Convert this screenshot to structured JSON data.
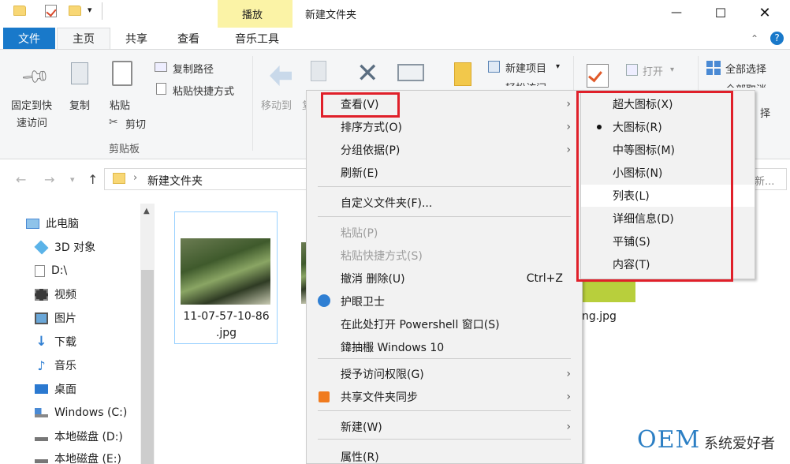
{
  "titlebar": {
    "contextual_tab": "播放",
    "title": "新建文件夹",
    "minimize": "—",
    "maximize": "☐",
    "close": "✕"
  },
  "tabs": {
    "file": "文件",
    "home": "主页",
    "share": "共享",
    "view": "查看",
    "music_tools": "音乐工具"
  },
  "ribbon": {
    "pin_label_1": "固定到快",
    "pin_label_2": "速访问",
    "copy": "复制",
    "paste": "粘贴",
    "copy_path": "复制路径",
    "paste_shortcut": "粘贴快捷方式",
    "cut": "剪切",
    "clipboard_group": "剪贴板",
    "move_to": "移动到",
    "move_to_tail": "复",
    "new_item": "新建项目",
    "easy_access": "轻松访问",
    "open": "打开",
    "select_all": "全部选择",
    "select_none": "全部取消",
    "invert_select_tail": "择"
  },
  "address": {
    "path": "新建文件夹",
    "search_tail": "新..."
  },
  "nav": {
    "items": [
      "此电脑",
      "3D 对象",
      "D:\\",
      "视频",
      "图片",
      "下载",
      "音乐",
      "桌面",
      "Windows (C:)",
      "本地磁盘 (D:)",
      "本地磁盘 (E:)"
    ]
  },
  "files": {
    "file1_line1": "11-07-57-10-86",
    "file1_line2": ".jpg",
    "file3_tail": "ng.jpg"
  },
  "context_menu": {
    "items": [
      {
        "label": "查看(V)",
        "submenu": true
      },
      {
        "label": "排序方式(O)",
        "submenu": true
      },
      {
        "label": "分组依据(P)",
        "submenu": true
      },
      {
        "label": "刷新(E)"
      },
      {
        "label": "自定义文件夹(F)..."
      },
      {
        "label": "粘贴(P)",
        "disabled": true
      },
      {
        "label": "粘贴快捷方式(S)",
        "disabled": true
      },
      {
        "label": "撤消 删除(U)",
        "accel": "Ctrl+Z"
      },
      {
        "label": "护眼卫士"
      },
      {
        "label": "在此处打开 Powershell 窗口(S)"
      },
      {
        "label": "鍏抽棴 Windows 10"
      },
      {
        "label": "授予访问权限(G)",
        "submenu": true
      },
      {
        "label": "共享文件夹同步",
        "submenu": true
      },
      {
        "label": "新建(W)",
        "submenu": true
      },
      {
        "label": "属性(R)"
      }
    ]
  },
  "view_submenu": {
    "selected": "大图标(R)",
    "items": [
      "超大图标(X)",
      "大图标(R)",
      "中等图标(M)",
      "小图标(N)",
      "列表(L)",
      "详细信息(D)",
      "平铺(S)",
      "内容(T)"
    ]
  },
  "watermark": {
    "brand": "OEM",
    "text": "系统爱好者"
  },
  "colors": {
    "file_tab": "#1979ca",
    "contextual_tab_bg": "#fbf3a6",
    "highlight_box": "#e0202a",
    "menu_bg": "#f2f2f2"
  }
}
